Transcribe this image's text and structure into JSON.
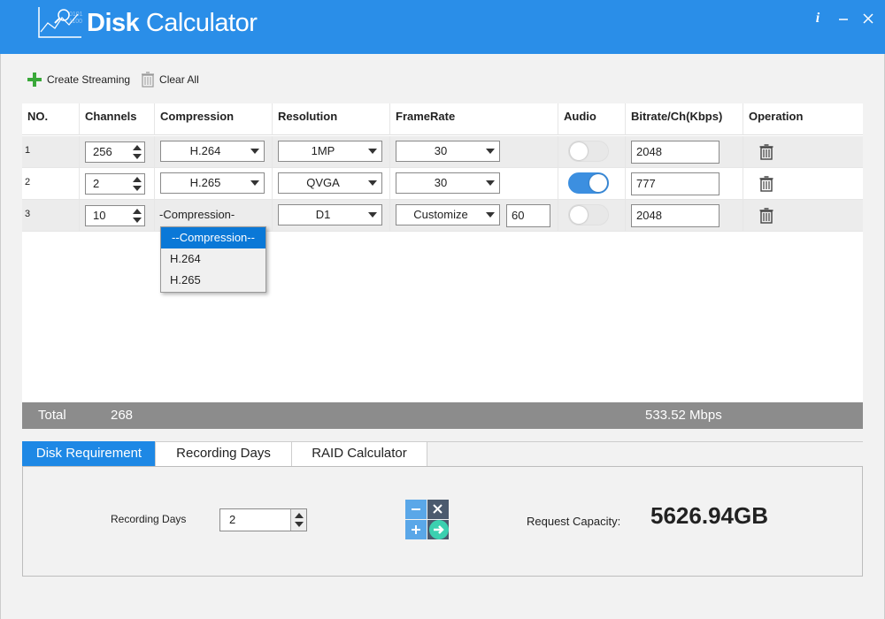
{
  "app": {
    "title_bold": "Disk",
    "title_rest": " Calculator",
    "info_icon": "info-icon",
    "min_icon": "minimize-icon",
    "close_icon": "close-icon"
  },
  "toolbar": {
    "create_label": "Create Streaming",
    "clear_label": "Clear All"
  },
  "table": {
    "headers": [
      "NO.",
      "Channels",
      "Compression",
      "Resolution",
      "FrameRate",
      "Audio",
      "Bitrate/Ch(Kbps)",
      "Operation"
    ],
    "rows": [
      {
        "no": "1",
        "channels": "256",
        "compression": "H.264",
        "resolution": "1MP",
        "framerate": "30",
        "custom_fps": "",
        "audio": false,
        "bitrate": "2048"
      },
      {
        "no": "2",
        "channels": "2",
        "compression": "H.265",
        "resolution": "QVGA",
        "framerate": "30",
        "custom_fps": "",
        "audio": true,
        "bitrate": "777"
      },
      {
        "no": "3",
        "channels": "10",
        "compression": "-Compression-",
        "resolution": "D1",
        "framerate": "Customize",
        "custom_fps": "60",
        "audio": false,
        "bitrate": "2048"
      }
    ]
  },
  "popup": {
    "options": [
      "--Compression--",
      "H.264",
      "H.265"
    ],
    "selected": "--Compression--"
  },
  "total": {
    "label": "Total",
    "channels": "268",
    "bitrate": "533.52 Mbps"
  },
  "tabs": [
    {
      "label": "Disk Requirement",
      "active": true
    },
    {
      "label": "Recording Days",
      "active": false
    },
    {
      "label": "RAID Calculator",
      "active": false
    }
  ],
  "disk": {
    "recording_days_label": "Recording Days",
    "recording_days_value": "2",
    "request_capacity_label": "Request Capacity:",
    "capacity_value": "5626.94GB"
  },
  "colors": {
    "titlebar": "#2a8ee8",
    "tab_active": "#1e88e5",
    "toggle_on": "#3c8fe0",
    "total_bar": "#8c8c8c",
    "plus_green": "#3aa83a"
  }
}
